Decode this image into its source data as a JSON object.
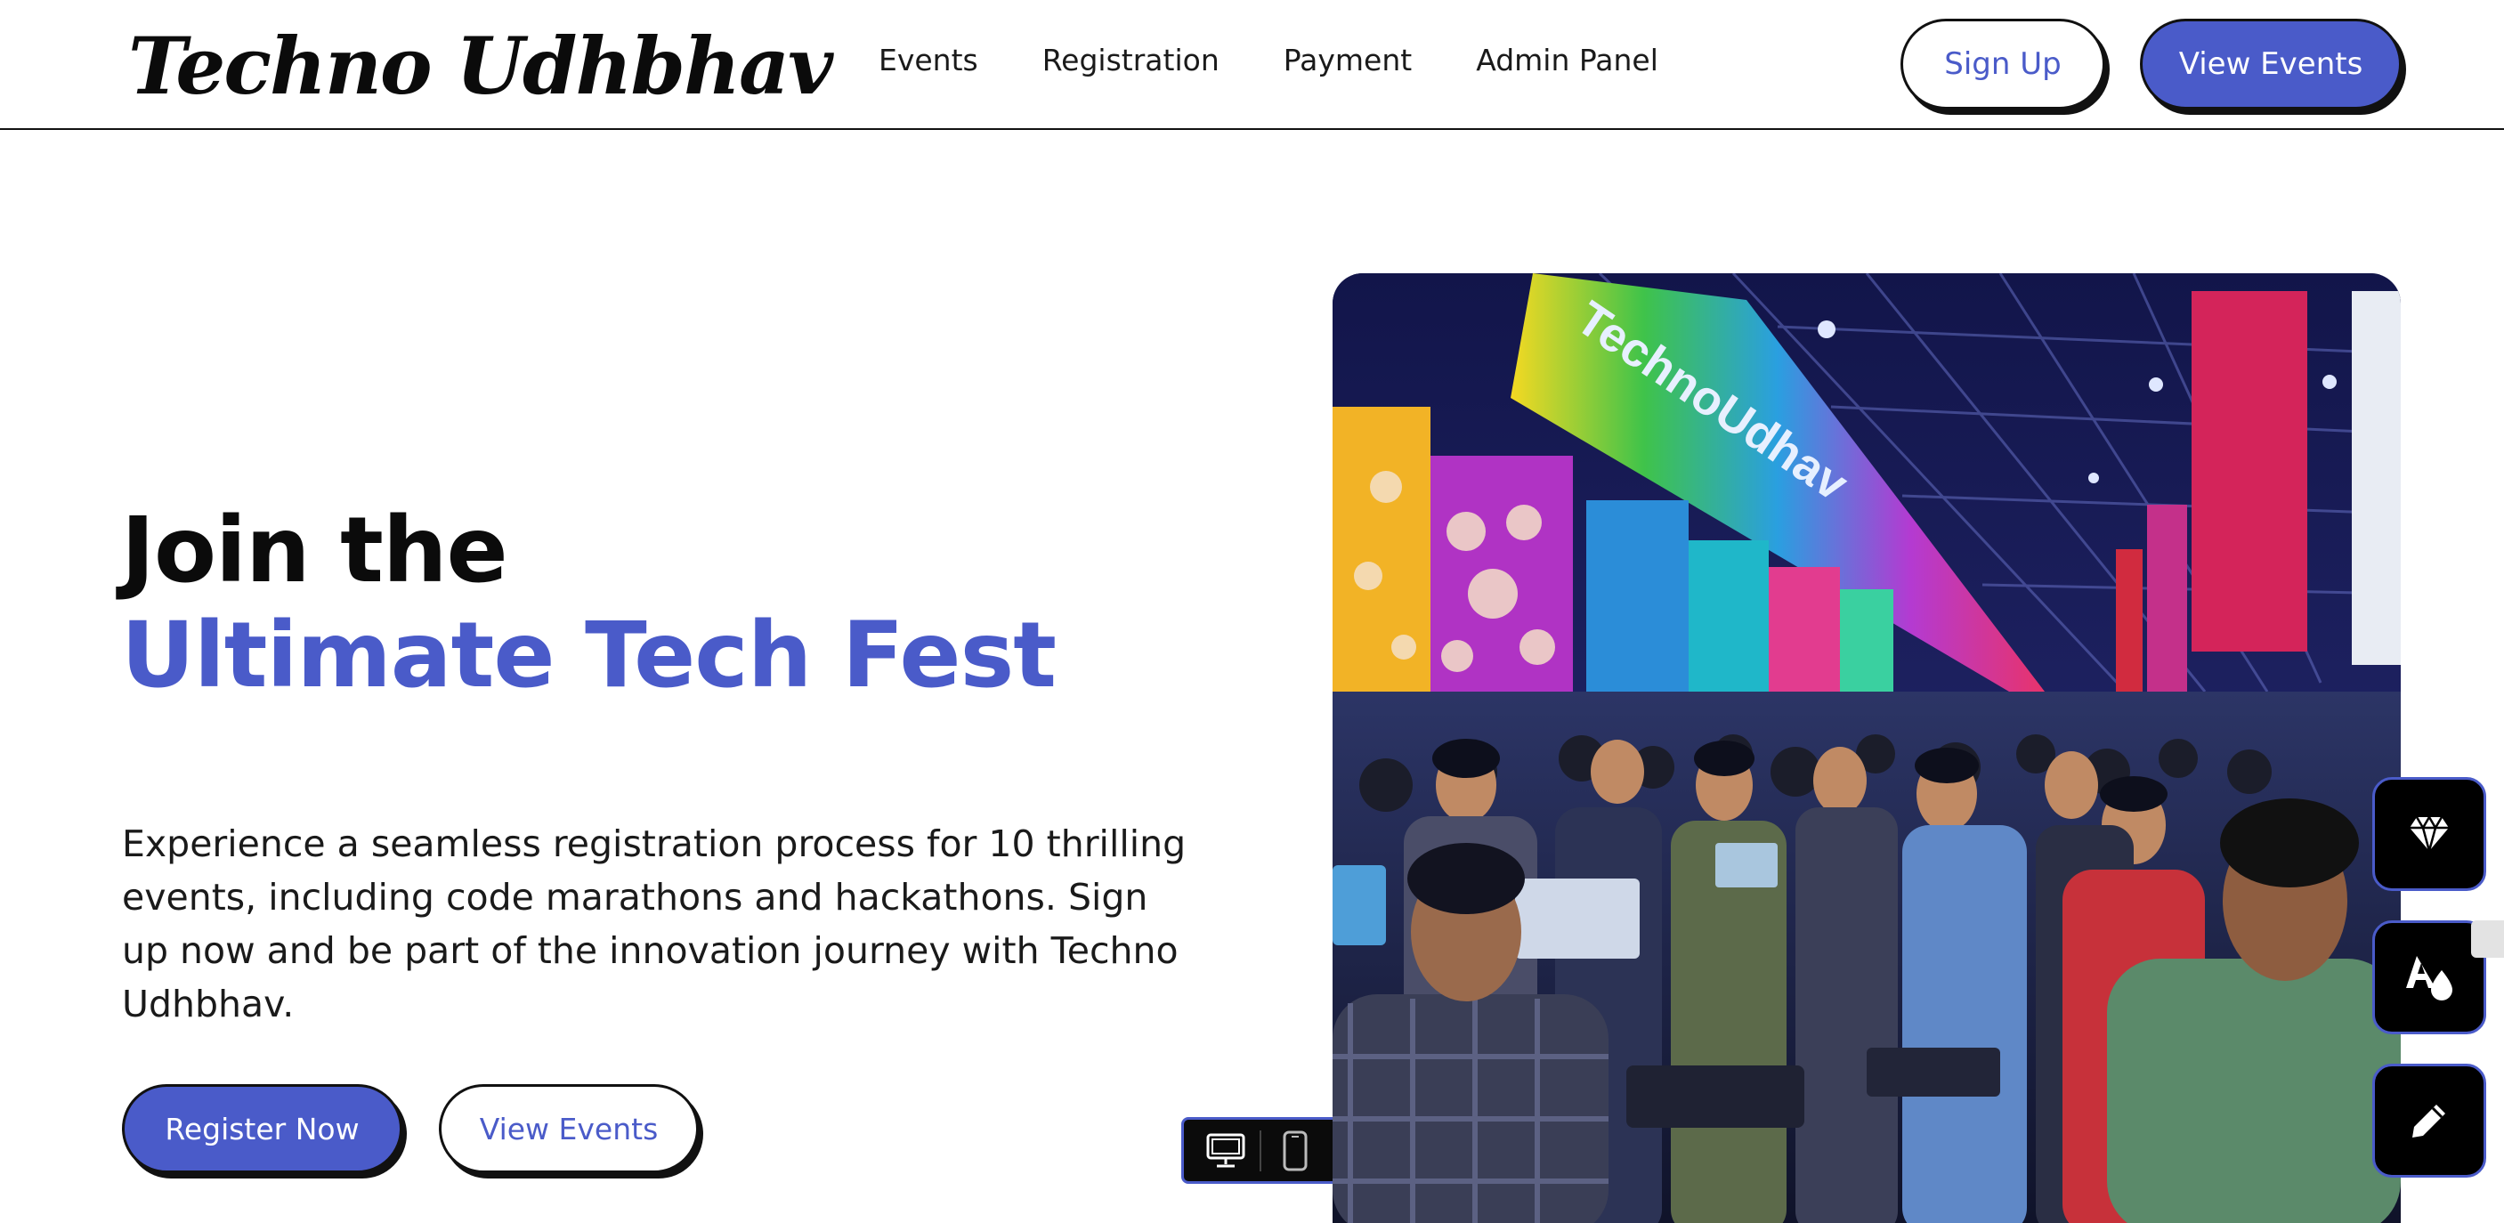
{
  "header": {
    "logo": "Techno Udhbhav",
    "nav": [
      "Events",
      "Registration",
      "Payment",
      "Admin Panel"
    ],
    "signup_label": "Sign Up",
    "view_events_label": "View Events"
  },
  "hero": {
    "title_line1": "Join the",
    "title_line2": "Ultimate Tech Fest",
    "description": "Experience a seamless registration process for 10 thrilling events, including code marathons and hackathons. Sign up now and be part of the innovation journey with Techno Udhbhav.",
    "register_label": "Register Now",
    "view_events_label": "View Events",
    "image_banner_text": "TechnoUdhav"
  },
  "device_toggle": {
    "icons": [
      "desktop-icon",
      "mobile-icon"
    ]
  },
  "tools": {
    "icons": [
      "gem-icon",
      "color-style-icon",
      "pencil-icon"
    ]
  },
  "colors": {
    "accent": "#4a5bc9",
    "text": "#0b0b0b",
    "background": "#ffffff"
  }
}
